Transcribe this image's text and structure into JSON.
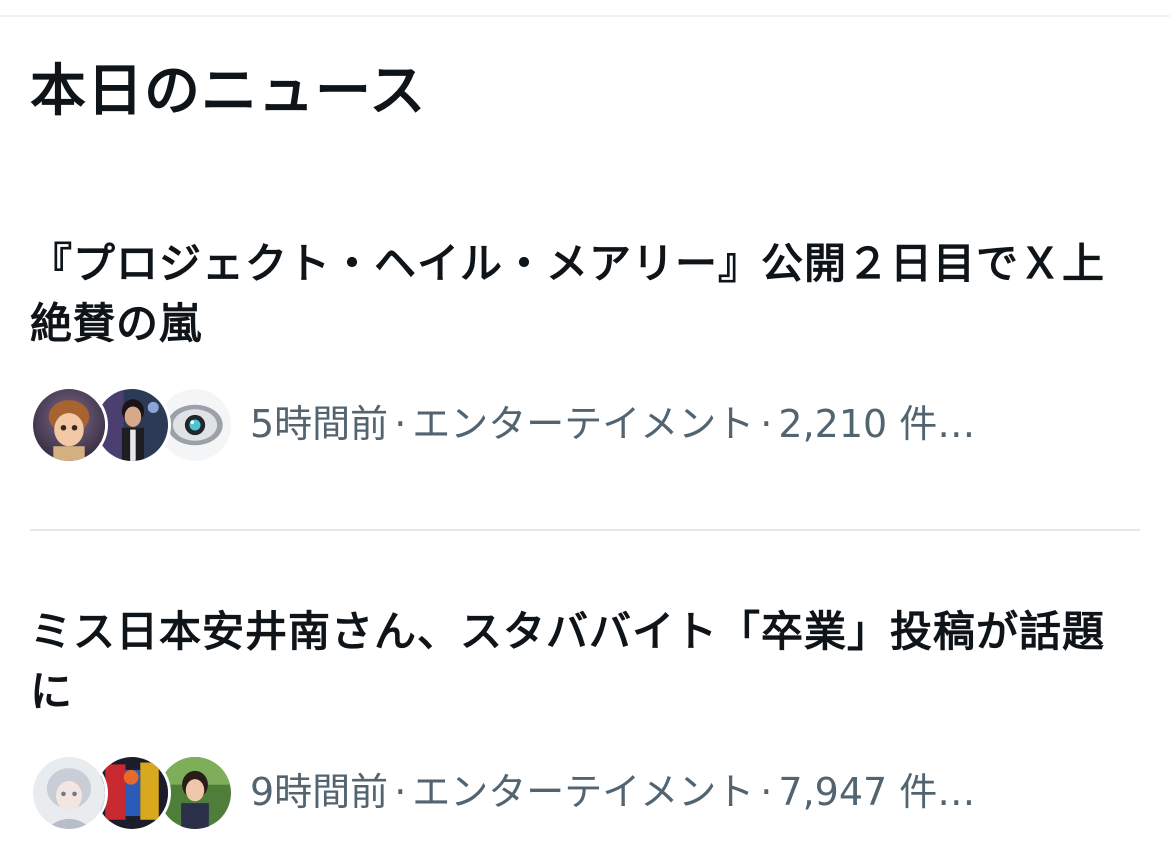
{
  "section": {
    "title": "本日のニュース"
  },
  "news": [
    {
      "headline": "『プロジェクト・ヘイル・メアリー』公開２日目でＸ上絶賛の嵐",
      "time": "5時間前",
      "category": "エンターテイメント",
      "count": "2,210 件…",
      "separator": "·",
      "avatar_icons": [
        "cartoon-character-avatar-icon",
        "man-portrait-avatar-icon",
        "robot-eye-avatar-icon"
      ]
    },
    {
      "headline": "ミス日本安井南さん、スタババイト「卒業」投稿が話題に",
      "time": "9時間前",
      "category": "エンターテイメント",
      "count": "7,947 件…",
      "separator": "·",
      "avatar_icons": [
        "anime-character-avatar-icon",
        "colorful-figure-avatar-icon",
        "woman-portrait-avatar-icon"
      ]
    }
  ],
  "colors": {
    "text_primary": "#0f1419",
    "text_secondary": "#536471",
    "divider": "#e6e9eb",
    "background": "#ffffff"
  }
}
